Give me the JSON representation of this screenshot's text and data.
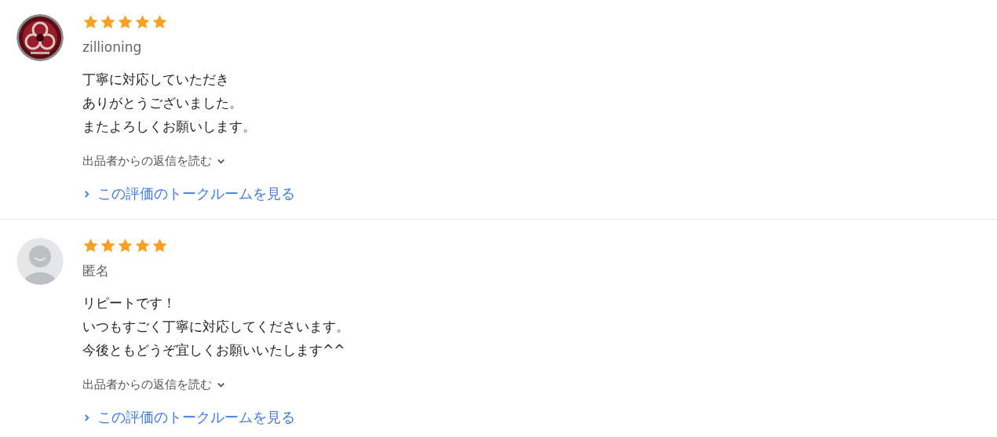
{
  "reviews": [
    {
      "stars": 5,
      "name": "zillioning",
      "comment_lines": [
        "丁寧に対応していただき",
        "ありがとうございました。",
        "またよろしくお願いします。"
      ],
      "reply_toggle": "出品者からの返信を読む",
      "expanded": false,
      "link": "この評価のトークルームを見る"
    },
    {
      "avatar": {
        "kind": "default"
      },
      "stars": 5,
      "name": "匿名",
      "comment_lines": [
        "リピートです！",
        "いつもすごく丁寧に対応してくださいます。",
        "今後ともどうぞ宜しくお願いいたします^^"
      ],
      "reply_toggle": "出品者からの返信を読む",
      "expanded": false,
      "link": "この評価のトークルームを見る"
    }
  ]
}
